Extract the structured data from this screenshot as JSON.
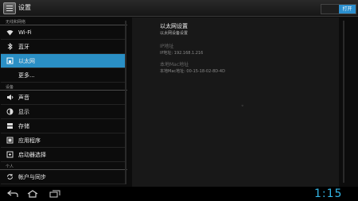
{
  "actionbar": {
    "title": "设置",
    "ethernet_toggle": "打开"
  },
  "sidebar": {
    "sections": [
      {
        "label": "无线和网络"
      },
      {
        "label": "设备"
      },
      {
        "label": "个人"
      }
    ],
    "items": [
      {
        "label": "Wi-Fi",
        "icon": "wifi-icon"
      },
      {
        "label": "蓝牙",
        "icon": "bluetooth-icon"
      },
      {
        "label": "以太网",
        "icon": "ethernet-icon",
        "selected": true
      },
      {
        "label": "更多..."
      },
      {
        "label": "声音",
        "icon": "speaker-icon"
      },
      {
        "label": "显示",
        "icon": "display-icon"
      },
      {
        "label": "存储",
        "icon": "storage-icon"
      },
      {
        "label": "应用程序",
        "icon": "apps-icon"
      },
      {
        "label": "启动器选择",
        "icon": "launcher-icon"
      },
      {
        "label": "帐户与同步",
        "icon": "sync-icon"
      }
    ]
  },
  "detail": {
    "title": "以太网设置",
    "subtitle": "以太网设备设置",
    "ip_heading": "IP地址",
    "ip_value": "IP地址: 192.168.1.216",
    "mac_heading": "本地Mac地址",
    "mac_value": "本地Mac地址: 00-15-18-02-8D-4D"
  },
  "navbar": {
    "clock": "1:15",
    "accent": "#33b5e5"
  },
  "colors": {
    "selection": "#2a8fc5",
    "panel": "#181818"
  }
}
